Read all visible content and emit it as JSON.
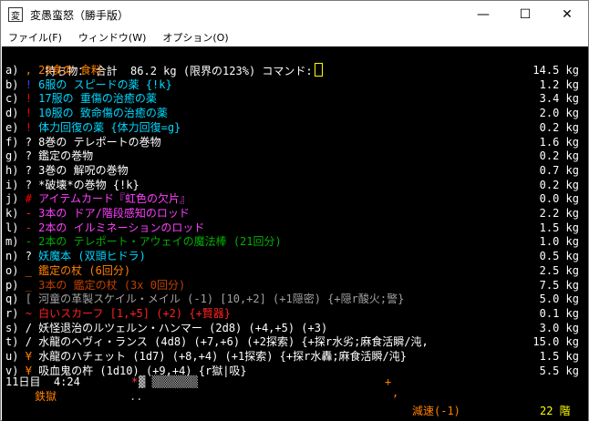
{
  "window": {
    "icon_name": "app-icon",
    "title": "変愚蛮怒（勝手版）",
    "controls": [
      "—",
      "☐",
      "✕"
    ]
  },
  "menu": [
    "ファイル(F)",
    "ウィンドウ(W)",
    "オプション(O)"
  ],
  "header": {
    "text": "持ち物： 合計  86.2 kg (限界の123%) コマンド:"
  },
  "inventory": [
    {
      "key": "a)",
      "sym": ",",
      "sym_color": "#ff8000",
      "name": "29食の 食料",
      "name_color": "#ff8000",
      "weight": "14.5 kg"
    },
    {
      "key": "b)",
      "sym": "!",
      "sym_color": "#4040ff",
      "name": "6服の スピードの薬 {!k}",
      "name_color": "#00d8ff",
      "weight": "1.2 kg"
    },
    {
      "key": "c)",
      "sym": "!",
      "sym_color": "#ff0000",
      "name": "17服の 重傷の治癒の薬",
      "name_color": "#00d8ff",
      "weight": "3.4 kg"
    },
    {
      "key": "d)",
      "sym": "!",
      "sym_color": "#ff0000",
      "name": "10服の 致命傷の治癒の薬",
      "name_color": "#00d8ff",
      "weight": "2.0 kg"
    },
    {
      "key": "e)",
      "sym": "!",
      "sym_color": "#ff0000",
      "name": "体力回復の薬 {体力回復=g}",
      "name_color": "#00d8ff",
      "weight": "0.2 kg"
    },
    {
      "key": "f)",
      "sym": "?",
      "sym_color": "#ffffff",
      "name": "8巻の テレポートの巻物",
      "name_color": "#ffffff",
      "weight": "1.6 kg"
    },
    {
      "key": "g)",
      "sym": "?",
      "sym_color": "#ffffff",
      "name": "鑑定の巻物",
      "name_color": "#ffffff",
      "weight": "0.2 kg"
    },
    {
      "key": "h)",
      "sym": "?",
      "sym_color": "#ffffff",
      "name": "3巻の 解呪の巻物",
      "name_color": "#ffffff",
      "weight": "0.7 kg"
    },
    {
      "key": "i)",
      "sym": "?",
      "sym_color": "#ffffff",
      "name": "*破壊*の巻物 {!k}",
      "name_color": "#ffffff",
      "weight": "0.2 kg"
    },
    {
      "key": "j)",
      "sym": "#",
      "sym_color": "#ff0000",
      "name": "アイテムカード『虹色の欠片』",
      "name_color": "#ff40ff",
      "weight": "0.0 kg"
    },
    {
      "key": "k)",
      "sym": "-",
      "sym_color": "#ff2020",
      "name": "3本の ドア/階段感知のロッド",
      "name_color": "#ff40ff",
      "weight": "2.2 kg"
    },
    {
      "key": "l)",
      "sym": "-",
      "sym_color": "#ff2020",
      "name": "2本の イルミネーションのロッド",
      "name_color": "#ff40ff",
      "weight": "1.5 kg"
    },
    {
      "key": "m)",
      "sym": "-",
      "sym_color": "#00b000",
      "name": "2本の テレポート・アウェイの魔法棒 (21回分)",
      "name_color": "#00b000",
      "weight": "1.0 kg"
    },
    {
      "key": "n)",
      "sym": "?",
      "sym_color": "#ffffff",
      "name": "妖魔本 (双頭ヒドラ)",
      "name_color": "#00d8ff",
      "weight": "0.5 kg"
    },
    {
      "key": "o)",
      "sym": "_",
      "sym_color": "#ff8000",
      "name": "鑑定の杖 (6回分)",
      "name_color": "#ff8000",
      "weight": "2.5 kg"
    },
    {
      "key": "p)",
      "sym": "_",
      "sym_color": "#c04000",
      "name": "3本の 鑑定の杖 (3x 0回分)",
      "name_color": "#c04000",
      "weight": "7.5 kg"
    },
    {
      "key": "q)",
      "sym": "[",
      "sym_color": "#a0a0a0",
      "name": "河童の革製スケイル・メイル (-1) [10,+2] (+1隠密) {+隠r酸火;警}",
      "name_color": "#a0a0a0",
      "weight": "5.0 kg"
    },
    {
      "key": "r)",
      "sym": "~",
      "sym_color": "#ff2020",
      "name": "白いスカーフ [1,+5] (+2) {+賢器}",
      "name_color": "#ff2020",
      "weight": "0.1 kg"
    },
    {
      "key": "s)",
      "sym": "/",
      "sym_color": "#ffffff",
      "name": "妖怪退治のルツェルン・ハンマー (2d8) (+4,+5) (+3)",
      "name_color": "#ffffff",
      "weight": "3.0 kg"
    },
    {
      "key": "t)",
      "sym": "/",
      "sym_color": "#ffffff",
      "name": "水龍のヘヴィ・ランス (4d8) (+7,+6) (+2探索) {+探r水劣;麻食活瞬/沌,",
      "name_color": "#ffffff",
      "weight": "15.0 kg"
    },
    {
      "key": "u)",
      "sym": "¥",
      "sym_color": "#ff8000",
      "name": "水龍のハチェット (1d7) (+8,+4) (+1探索) {+探r水轟;麻食活瞬/沌}",
      "name_color": "#ffffff",
      "weight": "1.5 kg"
    },
    {
      "key": "v)",
      "sym": "¥",
      "sym_color": "#ff8000",
      "name": "吸血鬼の杵 (1d10) (+9,+4) {r獄|吸}",
      "name_color": "#ffffff",
      "weight": "5.5 kg"
    }
  ],
  "status": {
    "day_time": "11日目  4:24",
    "location": "鉄獄",
    "speed": "減速(-1)",
    "depth": "22 階"
  },
  "map_fragments": {
    "row1_star": "*",
    "row1_blocks": "▓ ▒▒▒▒▒▒▒",
    "row1_plus": "+",
    "row2_dots": "..",
    "row2_comma": ","
  },
  "colors": {
    "terminal_bg": "#000000",
    "header_text": "#ffffff",
    "cursor": "#ffff00",
    "status_text": "#ffffff",
    "location_text": "#ff8000",
    "speed_text": "#ff8000",
    "depth_text": "#ffff00"
  }
}
